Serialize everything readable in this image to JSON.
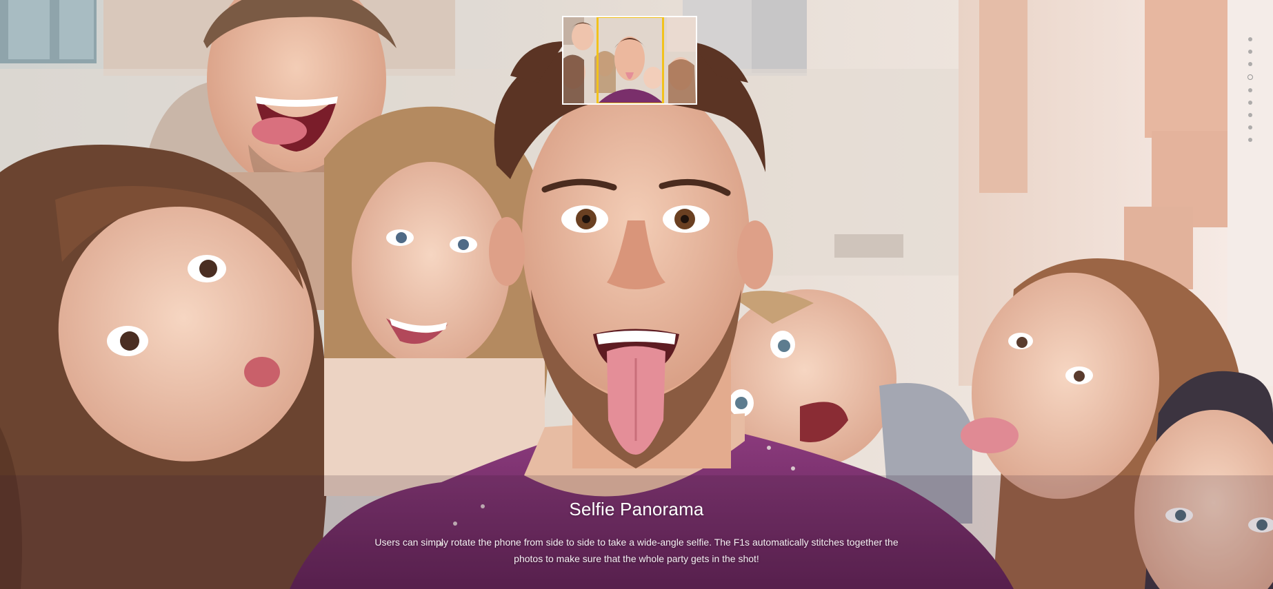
{
  "section": {
    "title": "Selfie Panorama",
    "description": "Users can simply rotate the phone from side to side to take a wide-angle selfie. The F1s automatically stitches together the photos to make sure that the whole party gets in the shot!"
  },
  "pagination": {
    "total": 9,
    "active_index": 3
  },
  "colors": {
    "highlight_frame": "#f2c21b",
    "thumb_border": "#ffffff",
    "caption_text": "#ffffff",
    "shirt": "#7a2f6b"
  },
  "icons": {
    "thumbnail": "panorama-preview-thumbnail",
    "dot": "pagination-dot"
  }
}
